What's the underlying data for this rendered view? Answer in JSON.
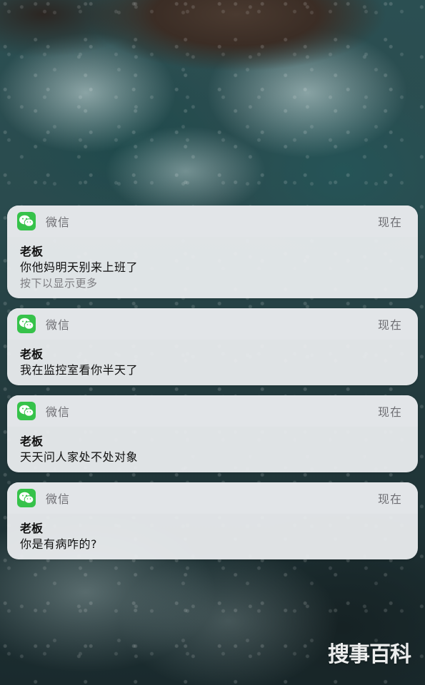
{
  "notifications": [
    {
      "app_name": "微信",
      "time": "现在",
      "sender": "老板",
      "message": "你他妈明天别来上班了",
      "hint": "按下以显示更多"
    },
    {
      "app_name": "微信",
      "time": "现在",
      "sender": "老板",
      "message": "我在监控室看你半天了"
    },
    {
      "app_name": "微信",
      "time": "现在",
      "sender": "老板",
      "message": "天天问人家处不处对象"
    },
    {
      "app_name": "微信",
      "time": "现在",
      "sender": "老板",
      "message": "你是有病咋的?"
    }
  ],
  "app_icon": "wechat-icon",
  "app_icon_color": "#36c24a",
  "watermark": "搜事百科"
}
